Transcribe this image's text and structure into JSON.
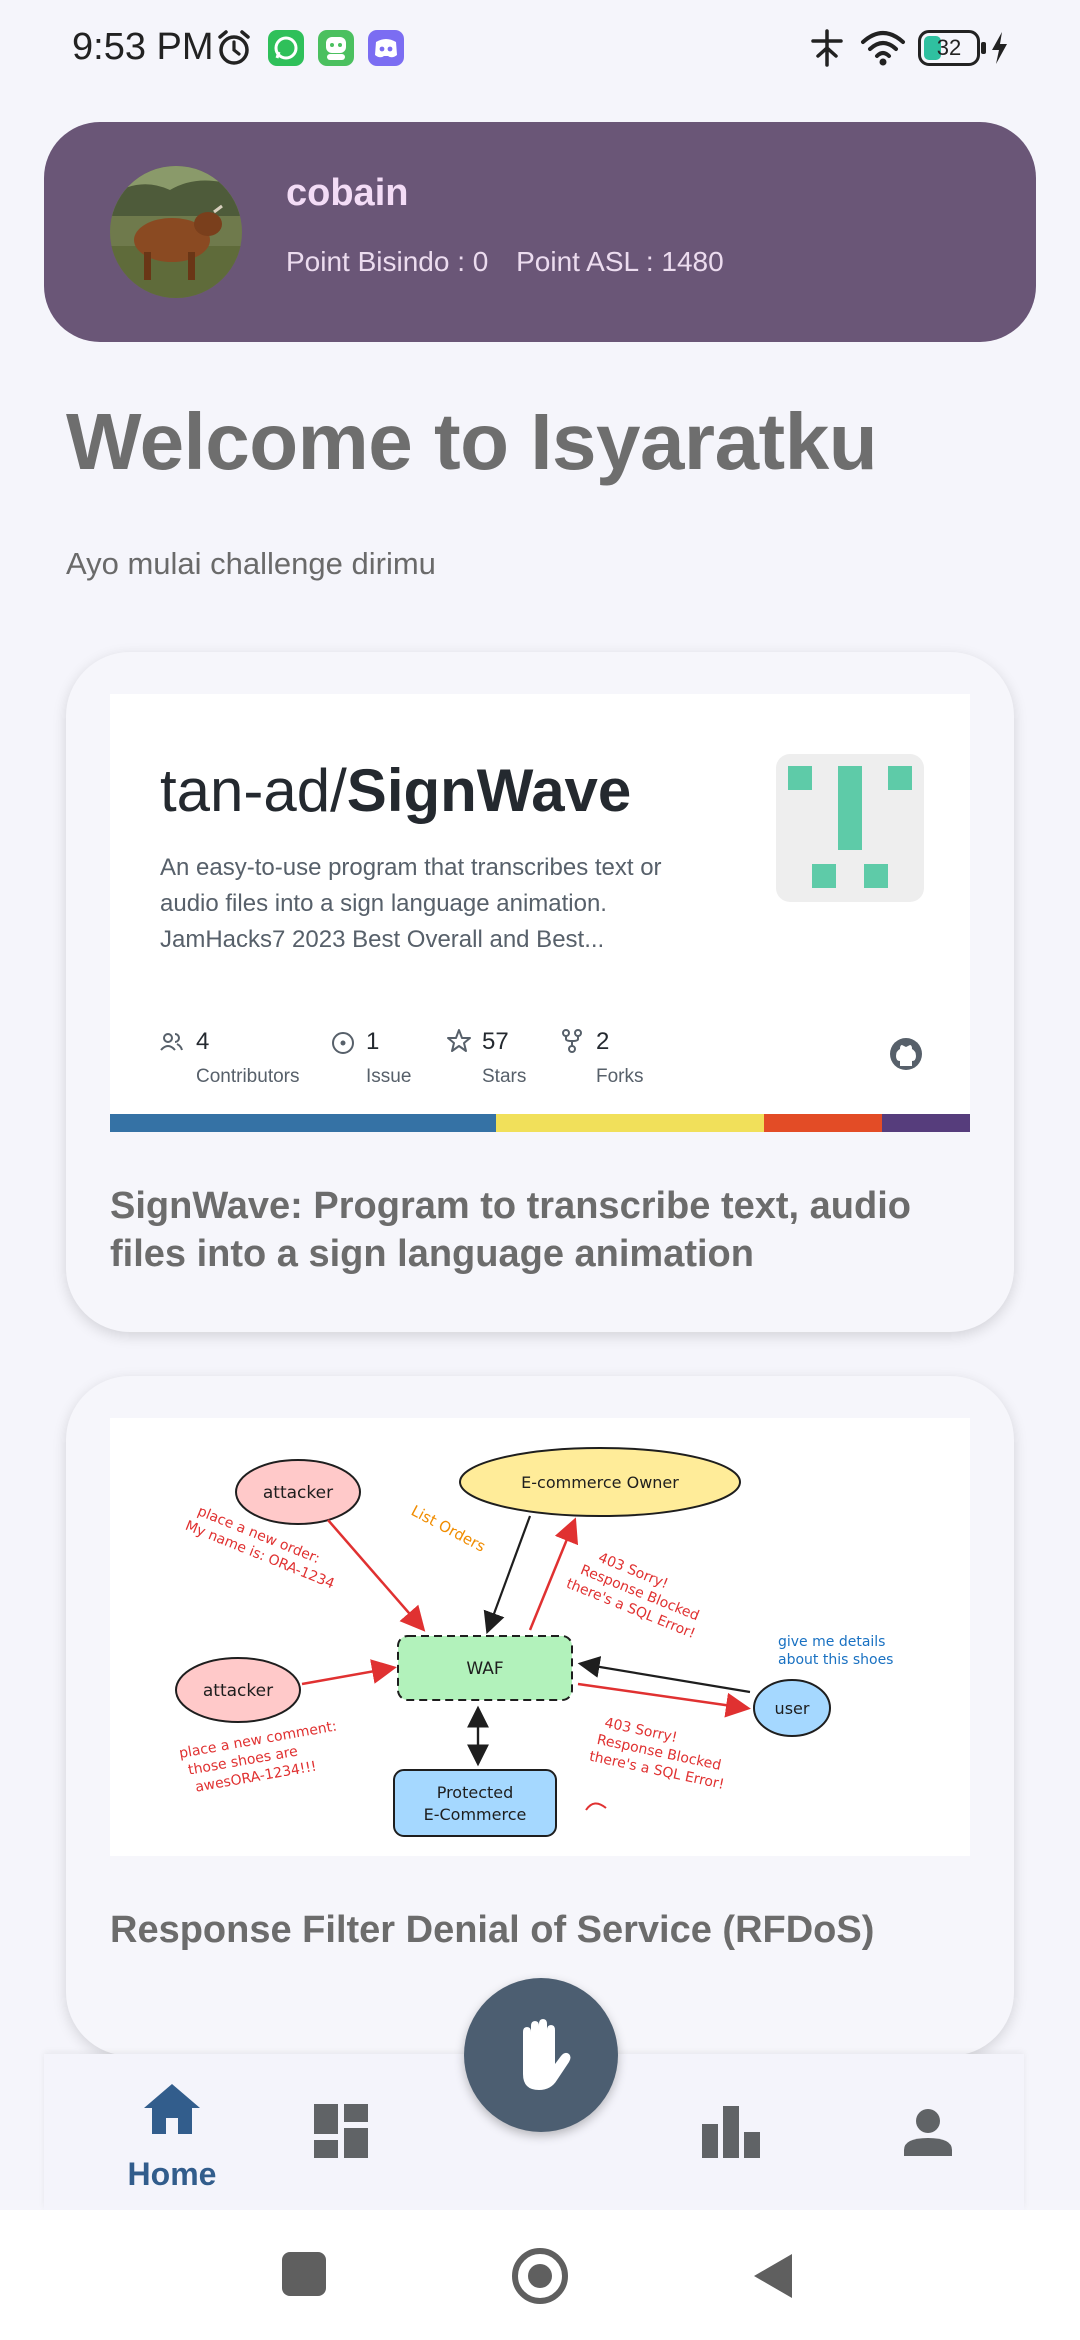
{
  "status_bar": {
    "time": "9:53 PM",
    "battery": "32",
    "icons": [
      "alarm-icon",
      "whatsapp-icon",
      "wechat-icon",
      "discord-icon",
      "signal-icon",
      "wifi-icon",
      "battery-icon",
      "charging-icon"
    ]
  },
  "profile": {
    "username": "cobain",
    "point_bisindo": "Point Bisindo : 0",
    "point_asl": "Point ASL : 1480"
  },
  "welcome": {
    "title": "Welcome to Isyaratku",
    "subtitle": "Ayo mulai challenge dirimu"
  },
  "cards": [
    {
      "title": "SignWave: Program to transcribe text, audio files into a sign language animation",
      "preview": {
        "owner": "tan-ad/",
        "repo": "SignWave",
        "description": "An easy-to-use program that transcribes text or audio files into a sign language animation. JamHacks7 2023 Best Overall and Best...",
        "contributors": "4",
        "contributors_label": "Contributors",
        "issues": "1",
        "issues_label": "Issue",
        "stars": "57",
        "stars_label": "Stars",
        "forks": "2",
        "forks_label": "Forks"
      }
    },
    {
      "title": "Response Filter Denial of Service (RFDoS)",
      "diagram": {
        "attacker_top": "attacker",
        "attacker_bottom": "attacker",
        "owner": "E-commerce Owner",
        "waf": "WAF",
        "user": "user",
        "protected_line1": "Protected",
        "protected_line2": "E-Commerce",
        "list_orders": "List Orders",
        "note_top_left_1": "place a new order:",
        "note_top_left_2": "My name is: ORA-1234",
        "note_bottom_left_1": "place a new comment:",
        "note_bottom_left_2": "those shoes are",
        "note_bottom_left_3": "awesORA-1234!!!",
        "sorry_top_1": "403 Sorry!",
        "sorry_top_2": "Response Blocked",
        "sorry_top_3": "there's a SQL Error!",
        "sorry_right_1": "403 Sorry!",
        "sorry_right_2": "Response Blocked",
        "sorry_right_3": "there's a SQL Error!",
        "user_note_1": "give me details",
        "user_note_2": "about this shoes"
      }
    }
  ],
  "bottom_nav": {
    "home_label": "Home",
    "items": [
      "home-icon",
      "dashboard-icon",
      "hand-icon",
      "leaderboard-icon",
      "profile-icon"
    ]
  },
  "colors": {
    "profile_bg": "#6a5677",
    "accent": "#325d8c",
    "fab": "#4c5e71"
  }
}
